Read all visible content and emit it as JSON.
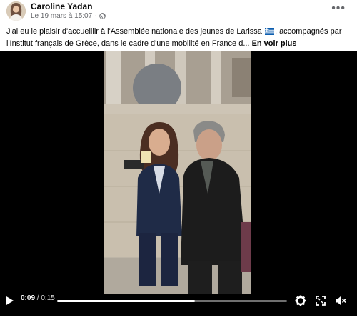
{
  "post": {
    "author": "Caroline Yadan",
    "timestamp": "Le 19 mars à 15:07",
    "audience_icon": "globe-icon",
    "more_icon": "more-horizontal-icon",
    "text_line1_a": "J'ai eu le plaisir d'accueillir à l'Assemblée nationale des jeunes de Larissa",
    "text_line1_b": ", accompagnés par",
    "text_line2": "l'Institut français de Grèce, dans le cadre d'une mobilité en France d...",
    "see_more": "En voir plus",
    "flag_icon": "greek-flag-icon"
  },
  "video": {
    "current_time": "0:09",
    "separator": "/",
    "duration": "0:15",
    "progress": 0.6,
    "play_icon": "play-icon",
    "settings_icon": "settings-gear-icon",
    "fullscreen_icon": "fullscreen-icon",
    "mute_icon": "muted-speaker-icon"
  },
  "colors": {
    "text": "#050505",
    "secondary": "#65676b",
    "video_bg": "#000000",
    "progress": "#ffffff"
  }
}
